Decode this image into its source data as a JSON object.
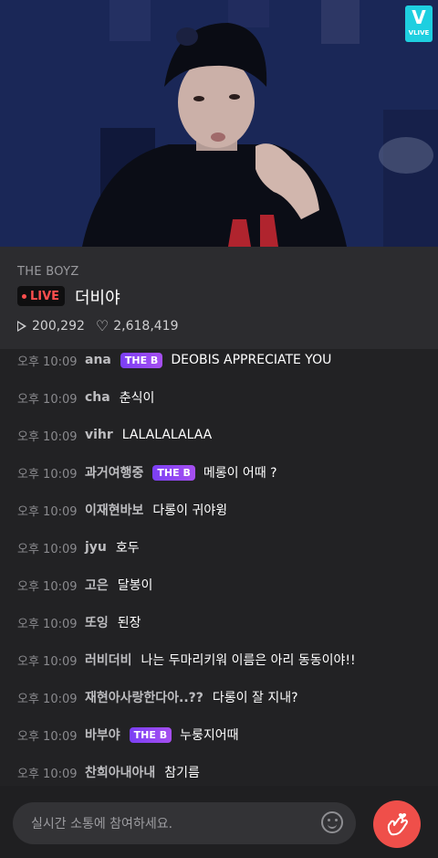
{
  "video": {
    "brand_badge": "VLIVE",
    "brand_letter": "V"
  },
  "info": {
    "channel": "THE BOYZ",
    "live_label": "LIVE",
    "title": "더비야",
    "plays": "200,292",
    "likes": "2,618,419"
  },
  "chat": [
    {
      "time": "오후 10:09",
      "nick": "ana",
      "badge": "THE B",
      "text": "DEOBIS APPRECIATE YOU"
    },
    {
      "time": "오후 10:09",
      "nick": "cha",
      "badge": "",
      "text": "춘식이"
    },
    {
      "time": "오후 10:09",
      "nick": "vihr",
      "badge": "",
      "text": "LALALALALAA"
    },
    {
      "time": "오후 10:09",
      "nick": "과거여행중",
      "badge": "THE B",
      "text": "메롱이 어때 ?"
    },
    {
      "time": "오후 10:09",
      "nick": "이재현바보",
      "badge": "",
      "text": "다롱이 귀야윙"
    },
    {
      "time": "오후 10:09",
      "nick": "jyu",
      "badge": "",
      "text": "호두"
    },
    {
      "time": "오후 10:09",
      "nick": "고은",
      "badge": "",
      "text": "달봉이"
    },
    {
      "time": "오후 10:09",
      "nick": "또잉",
      "badge": "",
      "text": "된장"
    },
    {
      "time": "오후 10:09",
      "nick": "러비더비",
      "badge": "",
      "text": "나는 두마리키워 이름은 아리 동동이야!!"
    },
    {
      "time": "오후 10:09",
      "nick": "재현아사랑한다아..??",
      "badge": "",
      "text": "다롱이 잘 지내?"
    },
    {
      "time": "오후 10:09",
      "nick": "바부야",
      "badge": "THE B",
      "text": "누룽지어때"
    },
    {
      "time": "오후 10:09",
      "nick": "찬희아내아내",
      "badge": "",
      "text": "참기름"
    }
  ],
  "composer": {
    "placeholder": "실시간 소통에 참여하세요."
  },
  "icons": {
    "play": "play-icon",
    "like": "heart-outline-icon",
    "emoji": "smiley-icon",
    "send_heart": "finger-heart-icon"
  },
  "colors": {
    "live": "#ff4e4e",
    "badge": "#8a44f2",
    "heart_button": "#ef4f4a",
    "brand": "#1ecfe0"
  }
}
